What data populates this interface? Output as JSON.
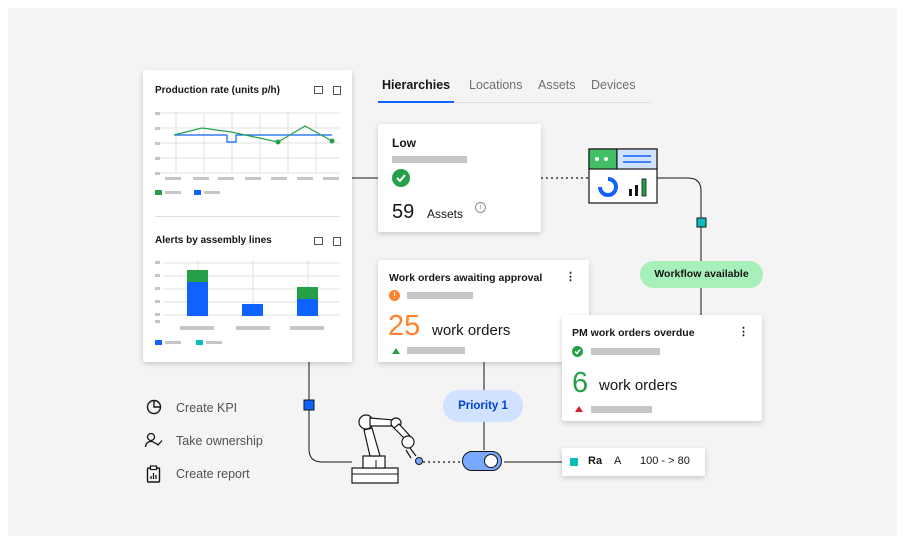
{
  "tabs": [
    "Hierarchies",
    "Locations",
    "Assets",
    "Devices"
  ],
  "active_tab": "Hierarchies",
  "production_card": {
    "title": "Production rate (units p/h)"
  },
  "alerts_card": {
    "title": "Alerts by assembly lines"
  },
  "low_card": {
    "title": "Low",
    "count": "59",
    "count_label": "Assets"
  },
  "approval_card": {
    "title": "Work orders awaiting approval",
    "count": "25",
    "count_label": "work orders"
  },
  "overdue_card": {
    "title": "PM work orders overdue",
    "count": "6",
    "count_label": "work orders"
  },
  "pills": {
    "workflow": "Workflow available",
    "priority": "Priority 1"
  },
  "rule_chip": {
    "col1": "Ra",
    "col2": "A",
    "col3": "100 - > 80"
  },
  "actions": [
    {
      "label": "Create KPI",
      "icon": "pie-chart-icon"
    },
    {
      "label": "Take ownership",
      "icon": "user-check-icon"
    },
    {
      "label": "Create report",
      "icon": "clipboard-report-icon"
    }
  ],
  "colors": {
    "blue": "#0f62fe",
    "green": "#24a148",
    "orange": "#ff832b",
    "teal": "#08bdba",
    "mint": "#a7f0ba",
    "pill_blue": "#d0e2ff"
  }
}
